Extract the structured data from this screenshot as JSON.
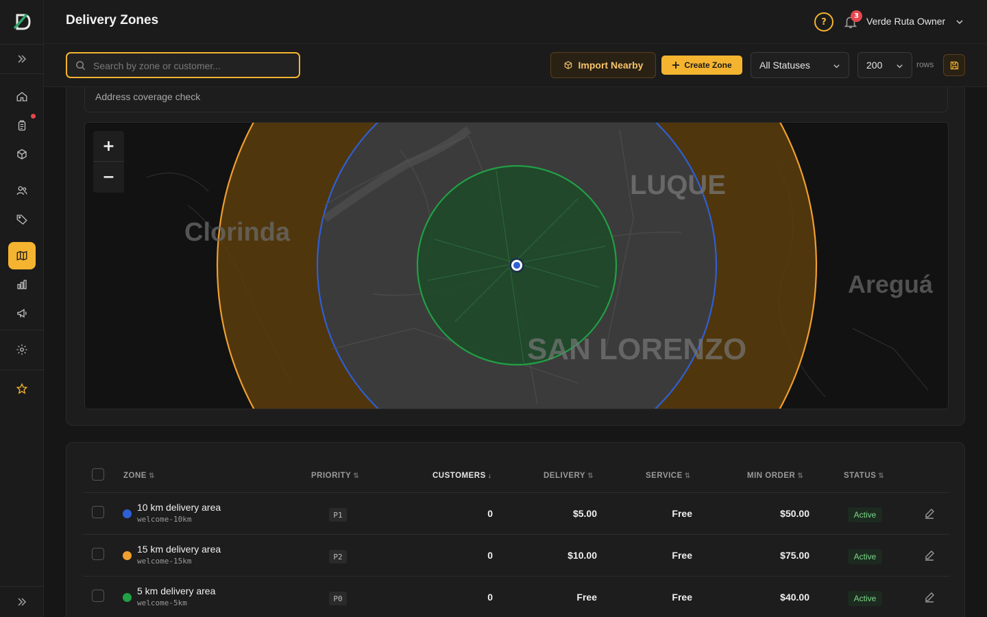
{
  "header": {
    "title": "Delivery Zones",
    "notification_count": "3",
    "user_name": "Verde Ruta Owner"
  },
  "toolbar": {
    "search_placeholder": "Search by zone or customer...",
    "import_label": "Import Nearby",
    "create_label": "Create Zone",
    "status_filter": "All Statuses",
    "rows_value": "200",
    "rows_label": "rows"
  },
  "map_section": {
    "coverage_label": "Address coverage check",
    "map_labels": [
      "LUQUE",
      "Clorinda",
      "Areguá",
      "SAN LORENZO"
    ],
    "zoom_in": "+",
    "zoom_out": "−"
  },
  "table": {
    "headers": {
      "zone": "ZONE",
      "priority": "PRIORITY",
      "customers": "CUSTOMERS",
      "delivery": "DELIVERY",
      "service": "SERVICE",
      "min_order": "MIN ORDER",
      "status": "STATUS"
    },
    "rows": [
      {
        "name": "10 km delivery area",
        "slug": "welcome-10km",
        "color": "#2f5fd6",
        "priority": "P1",
        "customers": "0",
        "delivery": "$5.00",
        "service": "Free",
        "min_order": "$50.00",
        "status": "Active"
      },
      {
        "name": "15 km delivery area",
        "slug": "welcome-15km",
        "color": "#f0a030",
        "priority": "P2",
        "customers": "0",
        "delivery": "$10.00",
        "service": "Free",
        "min_order": "$75.00",
        "status": "Active"
      },
      {
        "name": "5 km delivery area",
        "slug": "welcome-5km",
        "color": "#22a045",
        "priority": "P0",
        "customers": "0",
        "delivery": "Free",
        "service": "Free",
        "min_order": "$40.00",
        "status": "Active"
      }
    ]
  },
  "colors": {
    "accent": "#f5b430",
    "zone_5km": "#22a045",
    "zone_10km": "#2f5fd6",
    "zone_15km": "#f0a030"
  }
}
